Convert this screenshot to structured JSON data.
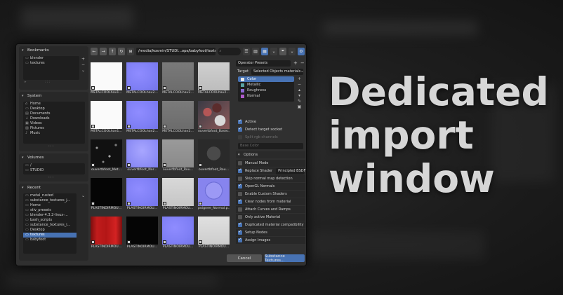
{
  "caption": {
    "lines": [
      "Dedicated",
      "import",
      "window"
    ]
  },
  "sidebar": {
    "bookmarks": {
      "title": "Bookmarks",
      "items": [
        "blender",
        "textures"
      ]
    },
    "system": {
      "title": "System",
      "items": [
        "Home",
        "Desktop",
        "Documents",
        "Downloads",
        "Videos",
        "Pictures",
        "Music"
      ]
    },
    "volumes": {
      "title": "Volumes",
      "items": [
        "/",
        "STUDIO"
      ]
    },
    "recent": {
      "title": "Recent",
      "items": [
        "metal_rusted",
        "substance_textures_j...",
        "Home",
        "stiv_presets",
        "blender-4.3.2-linux-...",
        "bash_scripts",
        "substance_textures_i...",
        "Desktop",
        "textures",
        "babyfoot"
      ],
      "selected_index": 8
    }
  },
  "toolbar": {
    "path": "/media/kosmin/STUDI...ops/babyfoot/textures/",
    "search_icon": "magnifier-icon"
  },
  "grid": {
    "rows": [
      [
        "METALCOOLhav1...",
        "METALCOOLhav2...",
        "METALCOOLhav2...",
        "METALCOOLhav2..."
      ],
      [
        "METALCOOLhav1...",
        "METALCOOLhav2...",
        "METALCOOLhav2...",
        "ouvertbfoot_Basec..."
      ],
      [
        "ouvertbfoot_Met...",
        "ouvertbfoot_Nor...",
        "ouvertbfoot_Rou...",
        "ouvertbfoot_Rou..."
      ],
      [
        "PLASTINOIRMOU...",
        "PLASTINOIRMOU...",
        "PLASTINOIRMOU...",
        "poignee_Normal.p..."
      ],
      [
        "PLASTINOIRMOU...",
        "PLASTINOIRMOU...",
        "PLASTINOIRMOU...",
        "PLASTINOIRMOU..."
      ]
    ]
  },
  "rpanel": {
    "presets_label": "Operator Presets",
    "target_label": "Target",
    "target_value": "Selected Objects materials",
    "slots": [
      {
        "name": "Color",
        "color": "#e8e8e8"
      },
      {
        "name": "Metallic",
        "color": "#5aa3a3"
      },
      {
        "name": "Roughness",
        "color": "#8d6ad6"
      },
      {
        "name": "Normal",
        "color": "#b05acc"
      }
    ],
    "active_label": "Active",
    "detect_label": "Detect target socket",
    "split_label": "Split rgb channels",
    "base_color_label": "Base Color",
    "options_label": "Options",
    "options": [
      {
        "label": "Manual Mode",
        "checked": false
      },
      {
        "label": "Replace Shader",
        "checked": true,
        "value": "Principled BSDF"
      },
      {
        "label": "Skip normal map detection",
        "checked": false
      },
      {
        "label": "OpenGL Normals",
        "checked": true
      },
      {
        "label": "Enable Custom Shaders",
        "checked": false
      },
      {
        "label": "Clear nodes from material",
        "checked": true
      },
      {
        "label": "Attach Curves and Ramps",
        "checked": false
      },
      {
        "label": "Only active Material",
        "checked": false
      },
      {
        "label": "Duplicated material compatibility",
        "checked": true
      },
      {
        "label": "Setup Nodes",
        "checked": true
      },
      {
        "label": "Assign Images",
        "checked": true
      }
    ]
  },
  "buttons": {
    "cancel": "Cancel",
    "confirm": "Substance Textures..."
  }
}
